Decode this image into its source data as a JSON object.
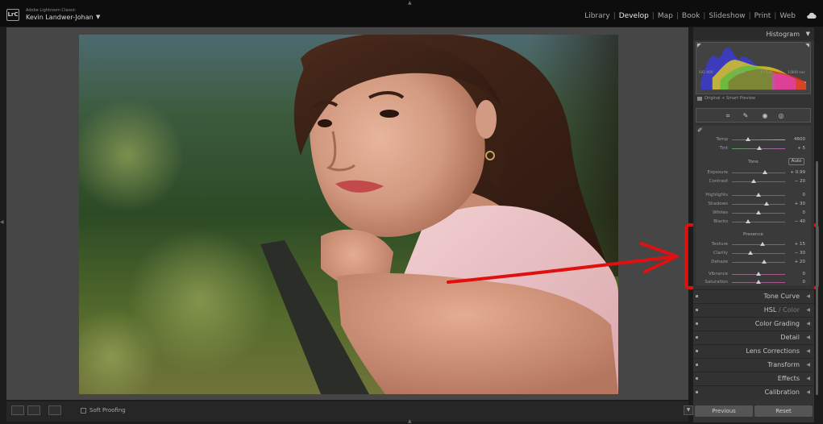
{
  "app": {
    "logo": "LrC",
    "subtitle": "Adobe Lightroom Classic",
    "user": "Kevin Landwer-Johan",
    "user_caret": "▼"
  },
  "modules": [
    {
      "label": "Library",
      "active": false
    },
    {
      "label": "Develop",
      "active": true
    },
    {
      "label": "Map",
      "active": false
    },
    {
      "label": "Book",
      "active": false
    },
    {
      "label": "Slideshow",
      "active": false
    },
    {
      "label": "Print",
      "active": false
    },
    {
      "label": "Web",
      "active": false
    }
  ],
  "histogram": {
    "title": "Histogram",
    "caret": "▼",
    "exposure_info": [
      "ISO 400",
      "105 mm",
      "ƒ / 1.8",
      "1/800 sec"
    ],
    "preview_label": "Original + Smart Preview"
  },
  "tools": [
    "crop-tool-icon",
    "healing-brush-icon",
    "red-eye-icon",
    "masking-icon"
  ],
  "basic": {
    "tone_label": "Tone",
    "auto_label": "Auto",
    "presence_label": "Presence",
    "sliders": [
      {
        "label": "Temp",
        "value": "4600",
        "position": 0.3
      },
      {
        "label": "Tint",
        "value": "+ 5",
        "position": 0.52
      },
      {
        "label": "Exposure",
        "value": "+ 0.99",
        "position": 0.62
      },
      {
        "label": "Contrast",
        "value": "− 20",
        "position": 0.41
      },
      {
        "label": "Highlights",
        "value": "0",
        "position": 0.5
      },
      {
        "label": "Shadows",
        "value": "+ 30",
        "position": 0.65
      },
      {
        "label": "Whites",
        "value": "0",
        "position": 0.5
      },
      {
        "label": "Blacks",
        "value": "− 40",
        "position": 0.3
      },
      {
        "label": "Texture",
        "value": "+ 15",
        "position": 0.57
      },
      {
        "label": "Clarity",
        "value": "− 30",
        "position": 0.35
      },
      {
        "label": "Dehaze",
        "value": "+ 20",
        "position": 0.6
      },
      {
        "label": "Vibrance",
        "value": "0",
        "position": 0.5
      },
      {
        "label": "Saturation",
        "value": "0",
        "position": 0.5
      }
    ]
  },
  "panels": {
    "tone_curve": "Tone Curve",
    "hsl": "HSL",
    "hsl_sep": "/",
    "color": "Color",
    "color_grading": "Color Grading",
    "detail": "Detail",
    "lens_corrections": "Lens Corrections",
    "transform": "Transform",
    "effects": "Effects",
    "calibration": "Calibration"
  },
  "toolbar": {
    "soft_proofing": "Soft Proofing"
  },
  "buttons": {
    "previous": "Previous",
    "reset": "Reset"
  },
  "colors": {
    "annotation": "#e01010",
    "active_module": "#eaeaea",
    "panel_bg": "#333333"
  }
}
